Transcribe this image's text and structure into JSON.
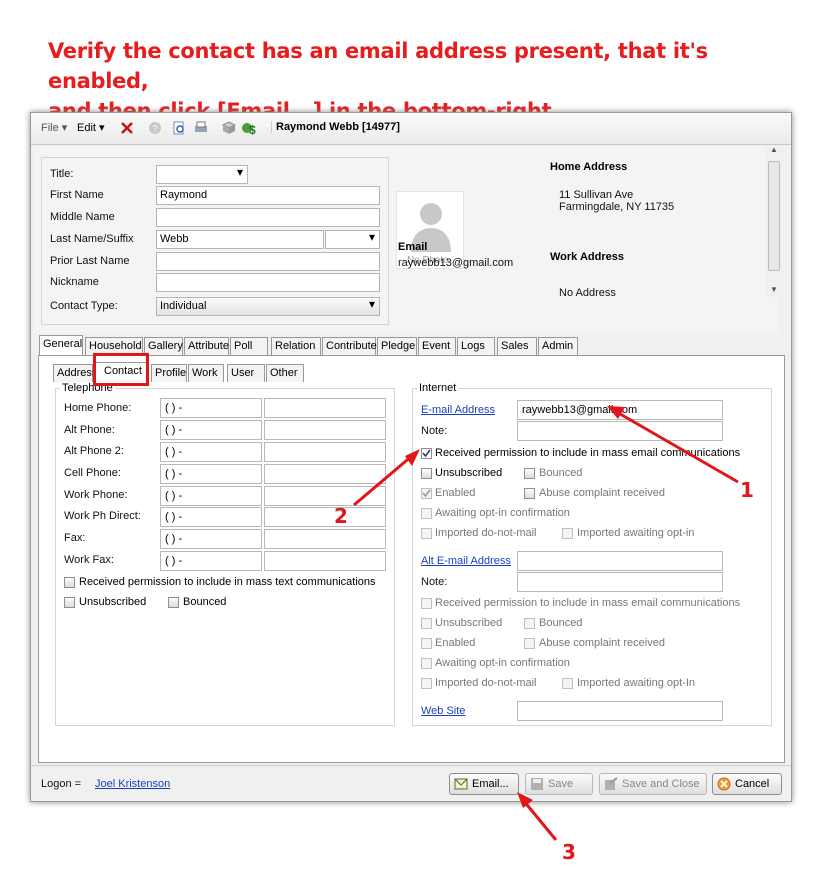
{
  "instruction": {
    "line1": "Verify the contact has an email address present, that it's enabled,",
    "line2": "and then click [Email...] in the bottom-right."
  },
  "toolbar": {
    "file": "File",
    "edit": "Edit",
    "title": "Raymond Webb [14977]"
  },
  "header": {
    "labels": {
      "title": "Title:",
      "first": "First Name",
      "middle": "Middle Name",
      "last": "Last Name/Suffix",
      "prior": "Prior Last Name",
      "nick": "Nickname",
      "type": "Contact Type:"
    },
    "values": {
      "title": "",
      "first": "Raymond",
      "middle": "",
      "last": "Webb",
      "suffix": "",
      "prior": "",
      "nick": "",
      "type": "Individual"
    },
    "photo": "No Photo",
    "email_label": "Email",
    "email": "raywebb13@gmail.com",
    "home_label": "Home Address",
    "home_line1": "11 Sullivan Ave",
    "home_line2": "Farmingdale, NY 11735",
    "work_label": "Work Address",
    "work": "No Address"
  },
  "tabs": [
    "General",
    "Household",
    "Gallery",
    "Attribute",
    "Poll",
    "Relation",
    "Contribute",
    "Pledge",
    "Event",
    "Logs",
    "Sales",
    "Admin"
  ],
  "subtabs": [
    "Address",
    "Contact",
    "Profile",
    "Work",
    "User",
    "Other"
  ],
  "telephone": {
    "legend": "Telephone",
    "rows": [
      {
        "label": "Home Phone:",
        "value": "(  )   -"
      },
      {
        "label": "Alt Phone:",
        "value": "(  )   -"
      },
      {
        "label": "Alt Phone 2:",
        "value": "(  )   -"
      },
      {
        "label": "Cell Phone:",
        "value": "(  )   -"
      },
      {
        "label": "Work Phone:",
        "value": "(  )   -"
      },
      {
        "label": "Work Ph Direct:",
        "value": "(  )   -"
      },
      {
        "label": "Fax:",
        "value": "(  )   -"
      },
      {
        "label": "Work Fax:",
        "value": "(  )   -"
      }
    ],
    "mass_text": "Received permission to include in mass text communications",
    "unsub": "Unsubscribed",
    "bounced": "Bounced"
  },
  "internet": {
    "legend": "Internet",
    "email_link": "E-mail Address",
    "email_value": "raywebb13@gmail.com",
    "note": "Note:",
    "mass_email": "Received permission to include in mass email communications",
    "unsub": "Unsubscribed",
    "bounced": "Bounced",
    "enabled": "Enabled",
    "abuse": "Abuse complaint received",
    "awaiting": "Awaiting opt-in confirmation",
    "imported": "Imported do-not-mail",
    "imported_await": "Imported awaiting opt-in",
    "alt_link": "Alt E-mail Address",
    "alt_note": "Note:",
    "alt_imported_await": "Imported awaiting opt-In",
    "web": "Web Site"
  },
  "status": {
    "logon": "Logon =",
    "user": "Joel Kristenson",
    "email_btn": "Email...",
    "save_btn": "Save",
    "save_close_btn": "Save and Close",
    "cancel_btn": "Cancel"
  },
  "annotations": {
    "n1": "1",
    "n2": "2",
    "n3": "3"
  },
  "colors": {
    "annotation": "#e0161b",
    "link": "#1a3fbf"
  }
}
